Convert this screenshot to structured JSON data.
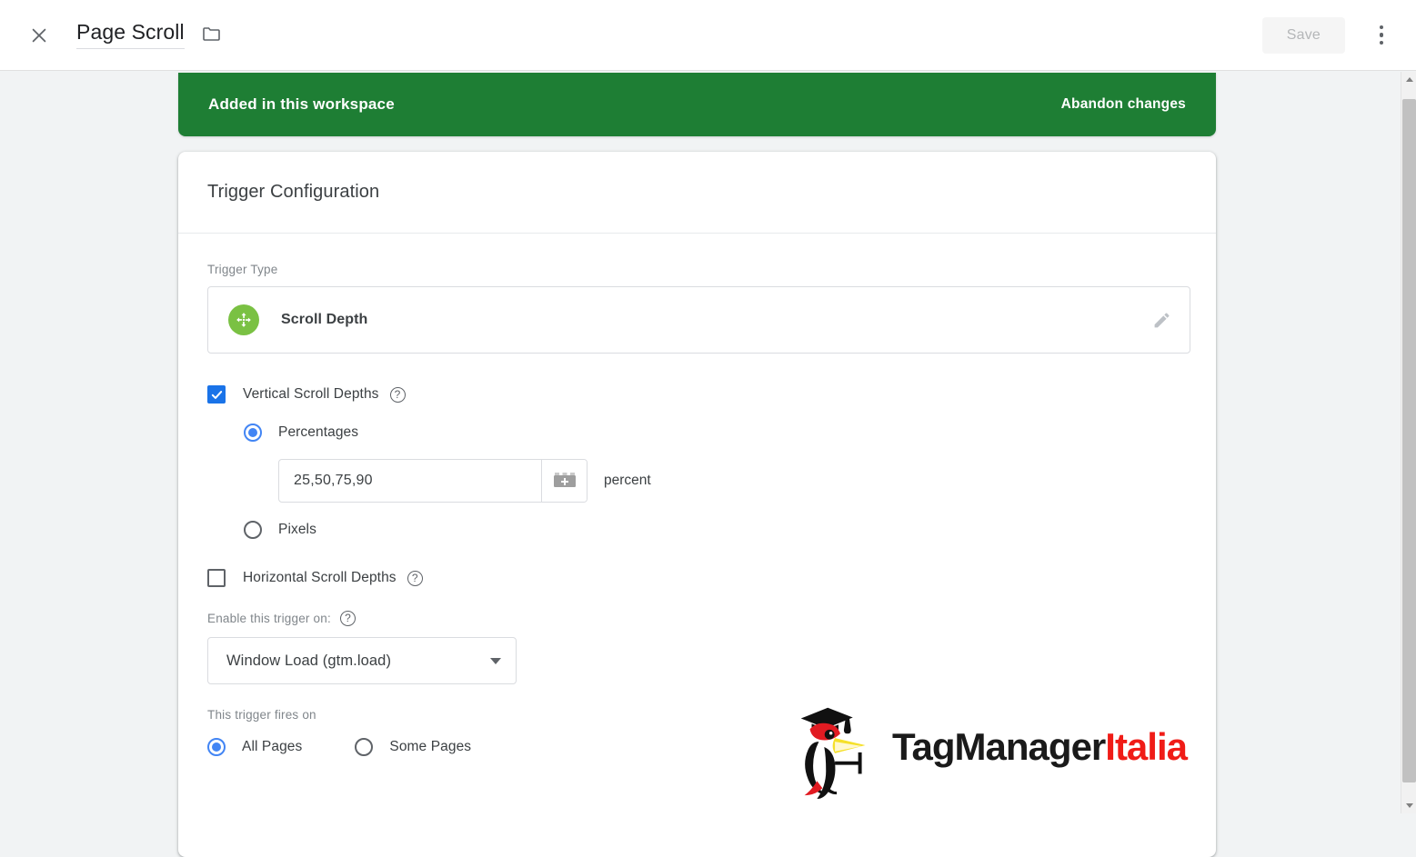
{
  "topbar": {
    "close_icon": "close-icon",
    "title": "Page Scroll",
    "folder_icon": "folder-icon",
    "save_label": "Save",
    "more_icon": "more-vert-icon"
  },
  "banner": {
    "message": "Added in this workspace",
    "action": "Abandon changes",
    "color": "#1e7e34"
  },
  "card": {
    "header": "Trigger Configuration",
    "trigger_type": {
      "label": "Trigger Type",
      "name": "Scroll Depth",
      "icon": "scroll-depth-move-icon",
      "icon_color": "#7ac143",
      "edit_icon": "pencil-icon"
    },
    "vertical": {
      "label": "Vertical Scroll Depths",
      "checked": true,
      "help_icon": "help-icon",
      "options": [
        {
          "label": "Percentages",
          "selected": true
        },
        {
          "label": "Pixels",
          "selected": false
        }
      ],
      "value": "25,50,75,90",
      "value_placeholder": "",
      "variable_icon": "insert-variable-icon",
      "unit": "percent"
    },
    "horizontal": {
      "label": "Horizontal Scroll Depths",
      "checked": false,
      "help_icon": "help-icon"
    },
    "enable_on": {
      "label": "Enable this trigger on:",
      "help_icon": "help-icon",
      "selected": "Window Load (gtm.load)",
      "caret_icon": "chevron-down-icon"
    },
    "fires_on": {
      "label": "This trigger fires on",
      "options": [
        {
          "label": "All Pages",
          "selected": true
        },
        {
          "label": "Some Pages",
          "selected": false
        }
      ]
    }
  },
  "logo": {
    "text_black": "TagManager",
    "text_red": "Italia",
    "bird_icon": "woodpecker-graduate-icon",
    "red_hex": "#f01c17"
  },
  "scrollbar": {
    "up_icon": "scroll-up-arrow-icon",
    "down_icon": "scroll-down-arrow-icon"
  }
}
